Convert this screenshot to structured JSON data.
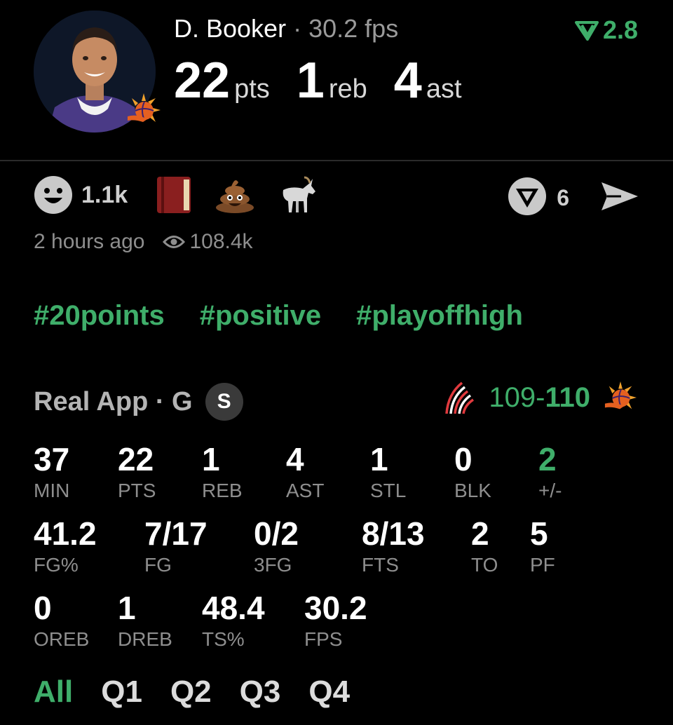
{
  "player": {
    "name": "D. Booker",
    "separator": "·",
    "fps_text": "30.2 fps",
    "rating": "2.8",
    "headline": [
      {
        "value": "22",
        "unit": "pts"
      },
      {
        "value": "1",
        "unit": "reb"
      },
      {
        "value": "4",
        "unit": "ast"
      }
    ]
  },
  "reactions": {
    "smile_count": "1.1k",
    "icons": [
      "smiley-face-icon",
      "book-emoji-icon",
      "poop-emoji-icon",
      "goat-emoji-icon"
    ],
    "comment_count": "6",
    "time_ago": "2 hours ago",
    "views": "108.4k"
  },
  "hashtags": [
    "#20points",
    "#positive",
    "#playoffhigh"
  ],
  "game": {
    "source": "Real App · G",
    "badge": "S",
    "score_away": "109",
    "score_dash": "-",
    "score_home": "110"
  },
  "stats": {
    "row1": [
      {
        "value": "37",
        "label": "MIN"
      },
      {
        "value": "22",
        "label": "PTS"
      },
      {
        "value": "1",
        "label": "REB"
      },
      {
        "value": "4",
        "label": "AST"
      },
      {
        "value": "1",
        "label": "STL"
      },
      {
        "value": "0",
        "label": "BLK"
      },
      {
        "value": "2",
        "label": "+/-"
      }
    ],
    "row2": [
      {
        "value": "41.2",
        "label": "FG%"
      },
      {
        "value": "7/17",
        "label": "FG"
      },
      {
        "value": "0/2",
        "label": "3FG"
      },
      {
        "value": "8/13",
        "label": "FTS"
      },
      {
        "value": "2",
        "label": "TO"
      },
      {
        "value": "5",
        "label": "PF"
      }
    ],
    "row3": [
      {
        "value": "0",
        "label": "OREB"
      },
      {
        "value": "1",
        "label": "DREB"
      },
      {
        "value": "48.4",
        "label": "TS%"
      },
      {
        "value": "30.2",
        "label": "FPS"
      }
    ]
  },
  "tabs": [
    "All",
    "Q1",
    "Q2",
    "Q3",
    "Q4"
  ],
  "colors": {
    "accent_green": "#3fae6a",
    "background": "#000000",
    "muted": "#8e8e8e"
  }
}
